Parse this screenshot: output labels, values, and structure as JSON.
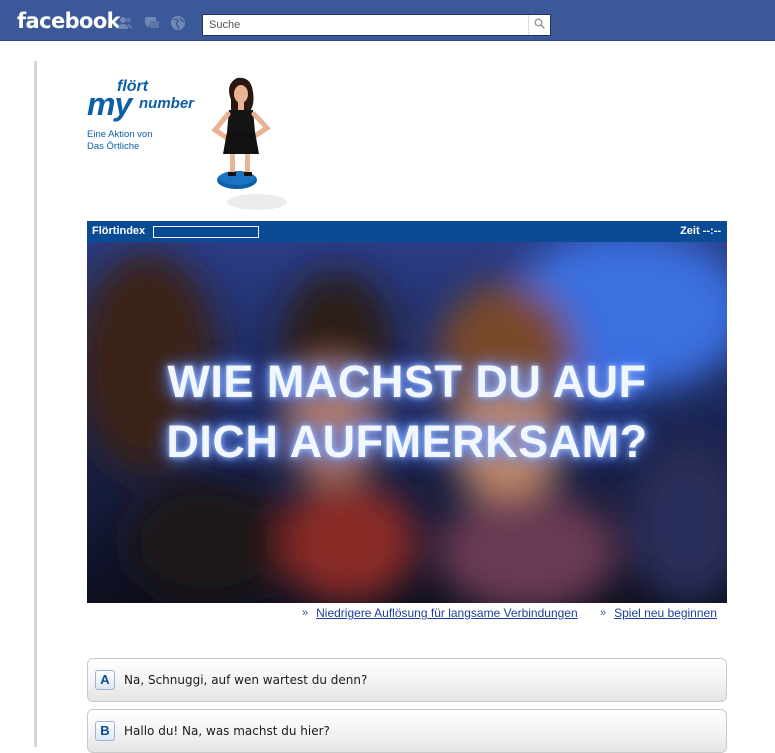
{
  "facebook": {
    "logo": "facebook",
    "search_placeholder": "Suche",
    "icons": [
      "friends-icon",
      "messages-icon",
      "notifications-globe-icon",
      "search-icon"
    ]
  },
  "app": {
    "logo_top": "flört",
    "logo_my": "my",
    "logo_number": "number",
    "tagline_line1": "Eine Aktion von",
    "tagline_line2": "Das Örtliche"
  },
  "game": {
    "flirt_label": "Flörtindex",
    "flirt_index_fraction": 0,
    "timer": "Zeit --:--",
    "question_line1": "WIE MACHST DU AUF",
    "question_line2": "DICH AUFMERKSAM?"
  },
  "links": {
    "low_res": "Niedrigere Auflösung für langsame Verbindungen",
    "restart": "Spiel neu beginnen"
  },
  "answers": [
    {
      "letter": "A",
      "text": "Na, Schnuggi, auf wen wartest du denn?"
    },
    {
      "letter": "B",
      "text": "Hallo du! Na, was machst du hier?"
    }
  ],
  "colors": {
    "facebook_blue": "#3b5998",
    "brand_blue": "#0a4b96",
    "link_blue": "#1e3f9a"
  }
}
